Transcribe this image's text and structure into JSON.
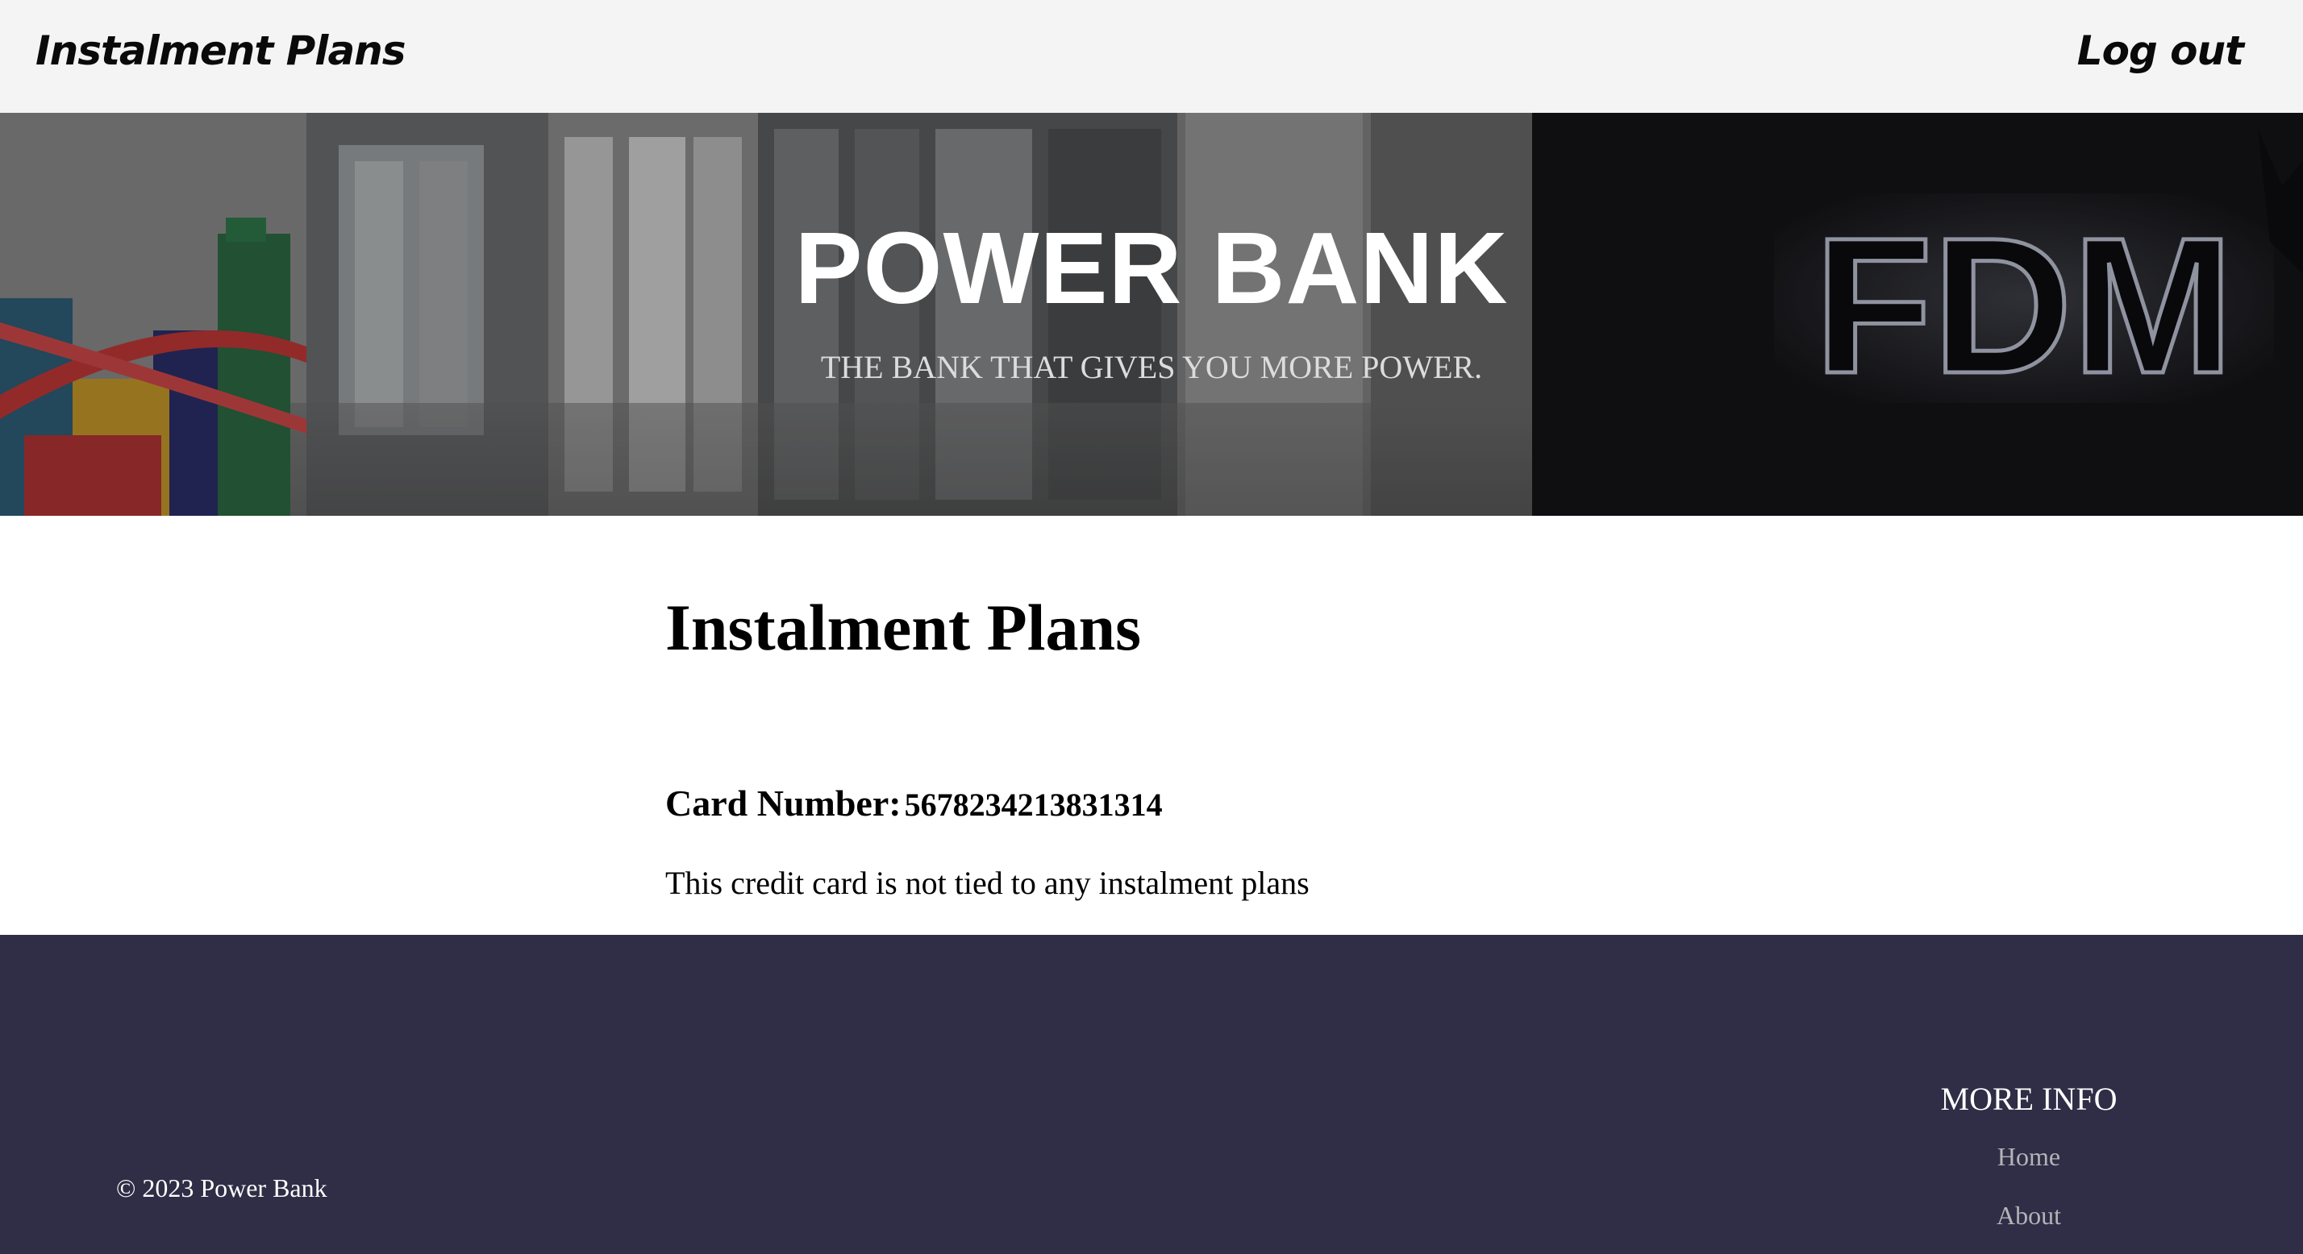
{
  "nav": {
    "brand": "Instalment Plans",
    "logout": "Log out"
  },
  "hero": {
    "title": "POWER BANK",
    "subtitle": "THE BANK THAT GIVES YOU MORE POWER.",
    "sign_text": "FDM"
  },
  "main": {
    "title": "Instalment Plans",
    "card_label": "Card Number:",
    "card_number": "5678234213831314",
    "message": "This credit card is not tied to any instalment plans"
  },
  "footer": {
    "copyright": "© 2023 Power Bank",
    "more_info_title": "MORE INFO",
    "links": [
      "Home",
      "About"
    ]
  },
  "colors": {
    "nav_bg": "#f4f4f4",
    "footer_bg": "#302d46",
    "footer_link": "#b3b3b8"
  }
}
